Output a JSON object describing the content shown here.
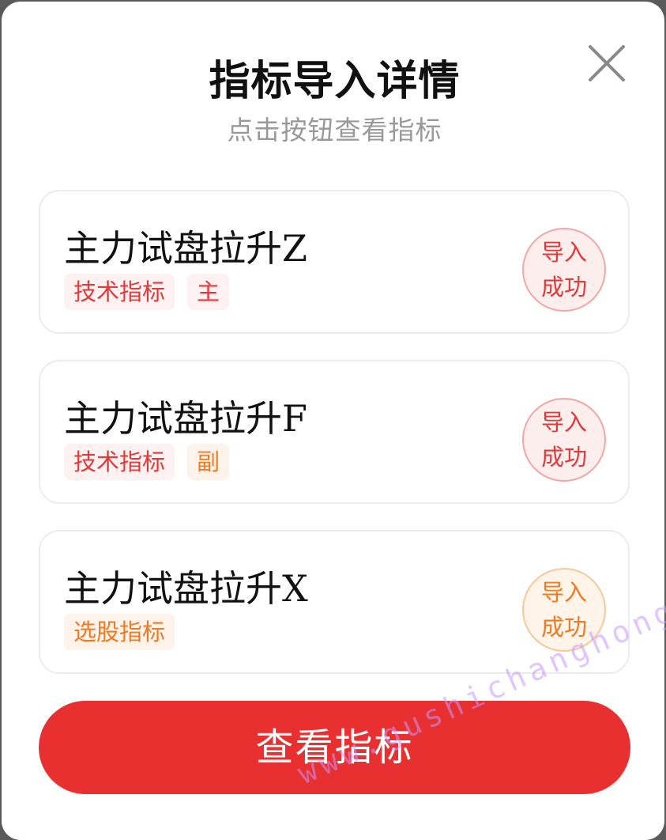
{
  "dialog": {
    "title": "指标导入详情",
    "subtitle": "点击按钮查看指标",
    "close_icon": "close-icon"
  },
  "items": [
    {
      "name_prefix": "主力试盘拉升",
      "name_suffix": "Z",
      "tags": [
        {
          "label": "技术指标",
          "color": "#e03a3a"
        },
        {
          "label": "主",
          "color": "#e03a3a"
        }
      ],
      "status_line1": "导入",
      "status_line2": "成功",
      "status_color": "#e03a3a"
    },
    {
      "name_prefix": "主力试盘拉升",
      "name_suffix": "F",
      "tags": [
        {
          "label": "技术指标",
          "color": "#e03a3a"
        },
        {
          "label": "副",
          "color": "#ee7a22"
        }
      ],
      "status_line1": "导入",
      "status_line2": "成功",
      "status_color": "#e03a3a"
    },
    {
      "name_prefix": "主力试盘拉升",
      "name_suffix": "X",
      "tags": [
        {
          "label": "选股指标",
          "color": "#ee7a22"
        }
      ],
      "status_line1": "导入",
      "status_line2": "成功",
      "status_color": "#ee7a22"
    }
  ],
  "primary_button": {
    "label": "查看指标",
    "color": "#e93030"
  },
  "watermark": "www.gushichanghong.com"
}
